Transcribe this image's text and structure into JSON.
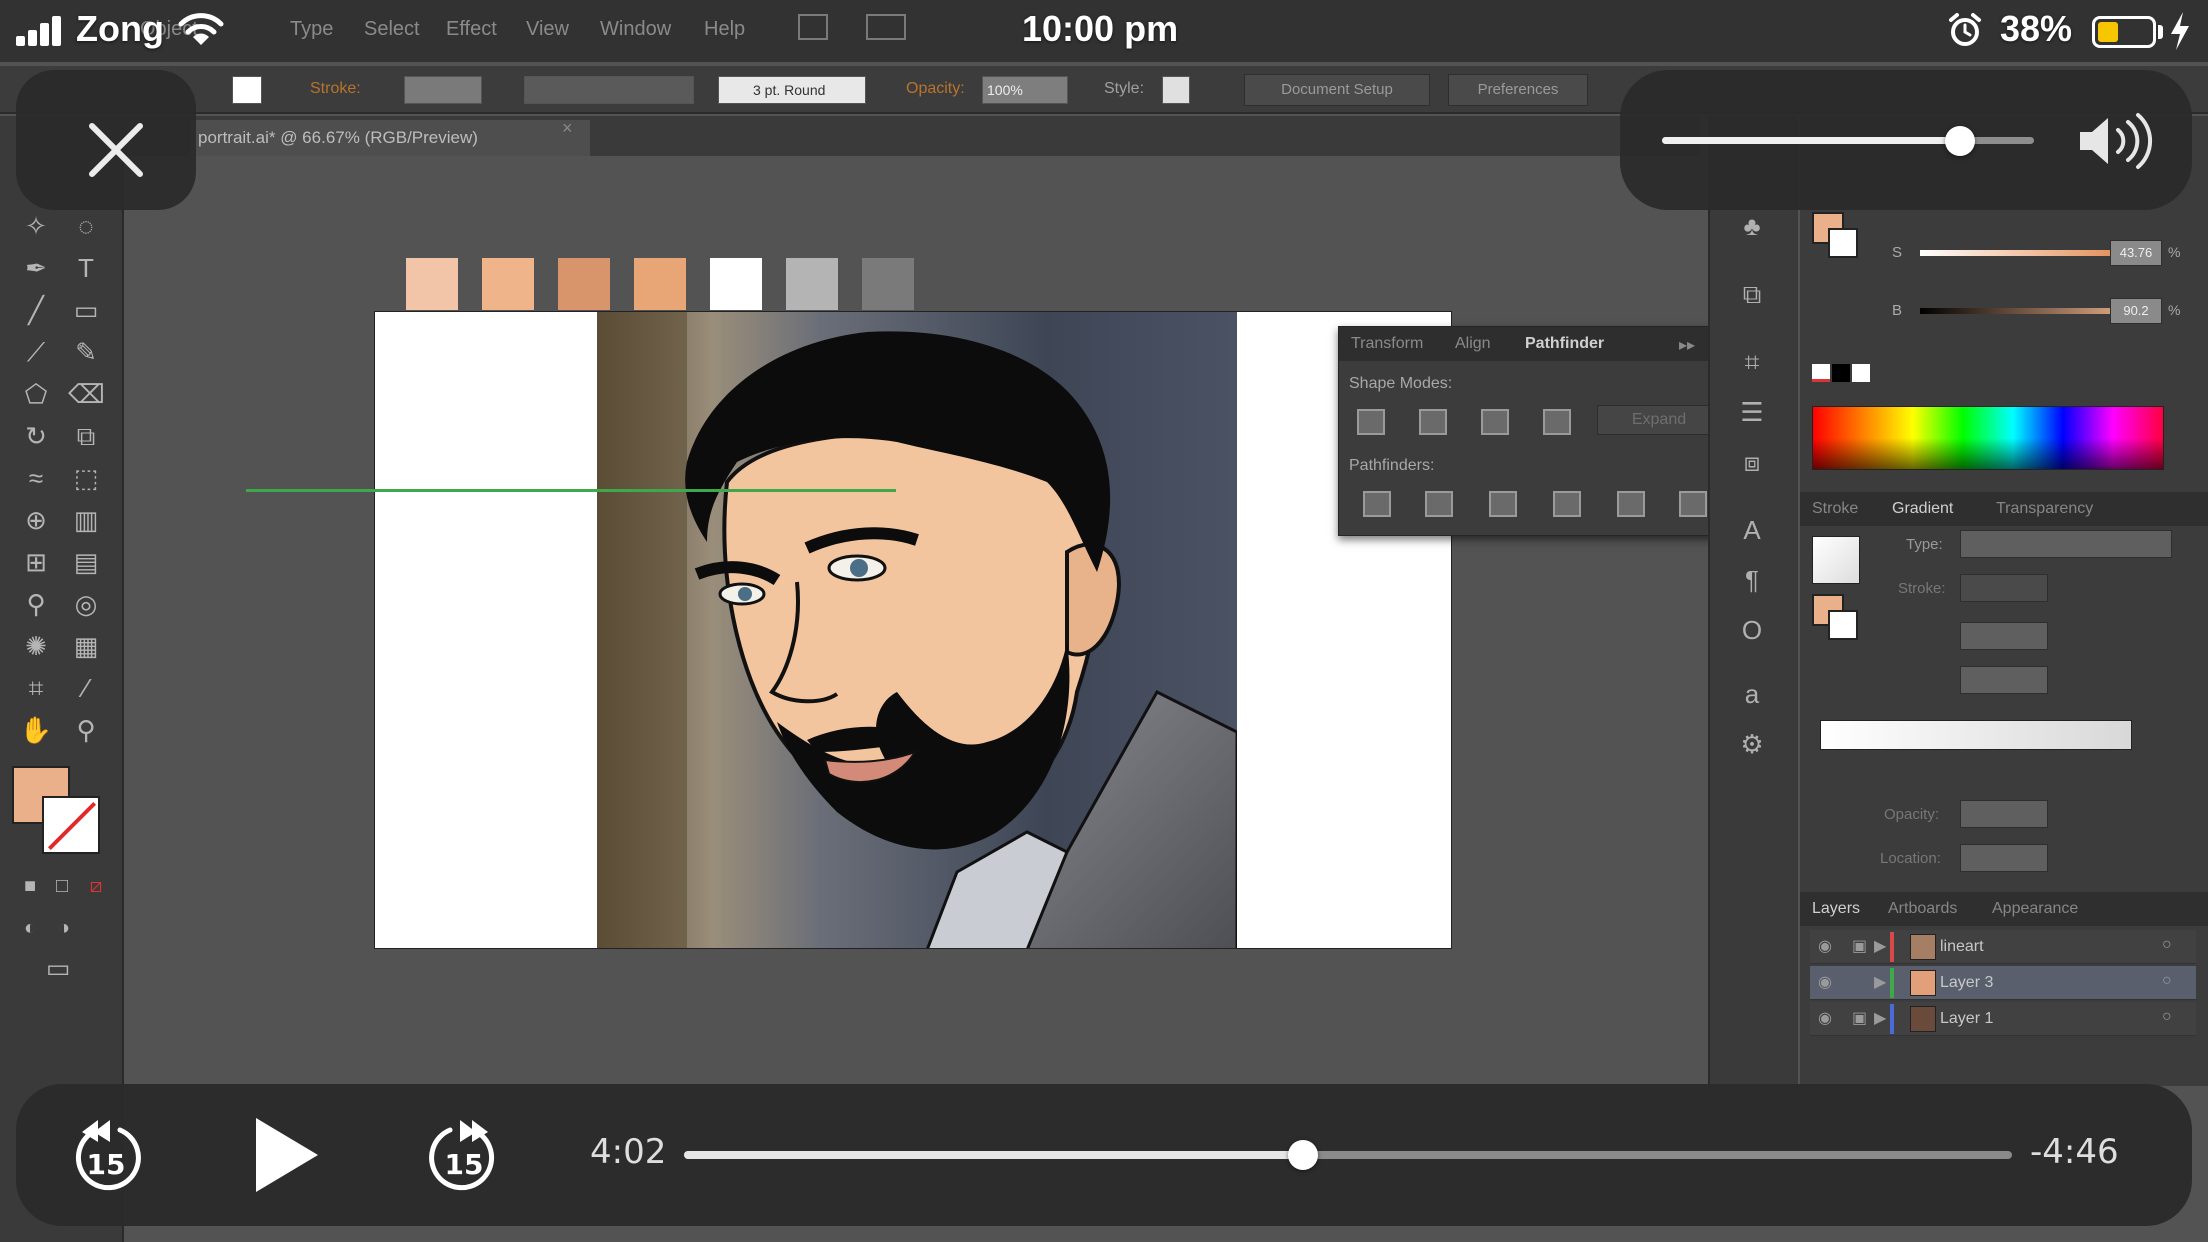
{
  "status_bar": {
    "carrier": "Zong",
    "time": "10:00 pm",
    "battery_percent": "38%",
    "battery_level": 0.38,
    "icons": [
      "signal-icon",
      "wifi-icon",
      "alarm-icon",
      "battery-icon",
      "charging-icon"
    ]
  },
  "illustrator": {
    "menus": [
      "Object",
      "Type",
      "Select",
      "Effect",
      "View",
      "Window",
      "Help"
    ],
    "control_bar": {
      "stroke_label": "Stroke:",
      "brush_value": "3 pt. Round",
      "opacity_label": "Opacity:",
      "opacity_value": "100%",
      "style_label": "Style:",
      "document_setup_button": "Document Setup",
      "preferences_button": "Preferences"
    },
    "document_tab": "portrait.ai* @ 66.67% (RGB/Preview)",
    "fill_color": "#eab08a",
    "reference_swatches": [
      "#f2c4a8",
      "#f0b48a",
      "#d8946a",
      "#e8a677",
      "#ffffff",
      "#b4b4b4",
      "#7a7a7a"
    ],
    "pathfinder_panel": {
      "tabs": [
        "Transform",
        "Align",
        "Pathfinder"
      ],
      "active_tab": "Pathfinder",
      "shape_modes_label": "Shape Modes:",
      "pathfinders_label": "Pathfinders:",
      "expand_button": "Expand"
    },
    "color_panel": {
      "s_label": "S",
      "b_label": "B",
      "s_value": "43.76",
      "b_value": "90.2",
      "percent": "%"
    },
    "gradient_panel": {
      "tabs": [
        "Stroke",
        "Gradient",
        "Transparency"
      ],
      "active_tab": "Gradient",
      "type_label": "Type:",
      "stroke_label": "Stroke:",
      "opacity_label": "Opacity:",
      "location_label": "Location:"
    },
    "layers_panel": {
      "tabs": [
        "Layers",
        "Artboards",
        "Appearance"
      ],
      "active_tab": "Layers",
      "layers": [
        {
          "name": "lineart",
          "color": "#d84a4a",
          "selected": false
        },
        {
          "name": "Layer 3",
          "color": "#3fa84a",
          "selected": true
        },
        {
          "name": "Layer 1",
          "color": "#4a6ad8",
          "selected": false
        }
      ]
    }
  },
  "player": {
    "close_icon": "close-icon",
    "volume_level": 0.8,
    "volume_icon": "speaker-icon",
    "skip_back_seconds": "15",
    "skip_forward_seconds": "15",
    "play_icon": "play-icon",
    "elapsed": "4:02",
    "remaining": "-4:46",
    "progress": 0.4658
  }
}
